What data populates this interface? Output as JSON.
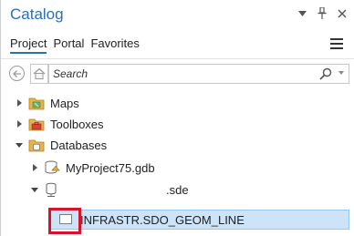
{
  "window": {
    "title": "Catalog",
    "icons": [
      "chevron-down-icon",
      "pin-icon",
      "close-icon"
    ]
  },
  "tabs": [
    {
      "label": "Project",
      "active": true
    },
    {
      "label": "Portal",
      "active": false
    },
    {
      "label": "Favorites",
      "active": false
    }
  ],
  "search": {
    "placeholder": "Search"
  },
  "tree": {
    "maps": "Maps",
    "toolboxes": "Toolboxes",
    "databases": "Databases",
    "gdb": "MyProject75.gdb",
    "sde_suffix": ".sde",
    "feature_class": "INFRASTR.SDO_GEOM_LINE"
  },
  "colors": {
    "accent": "#2b6fb5",
    "selection": "#cce3f8",
    "highlight_box": "#d3142a",
    "folder": "#e8b44a"
  }
}
